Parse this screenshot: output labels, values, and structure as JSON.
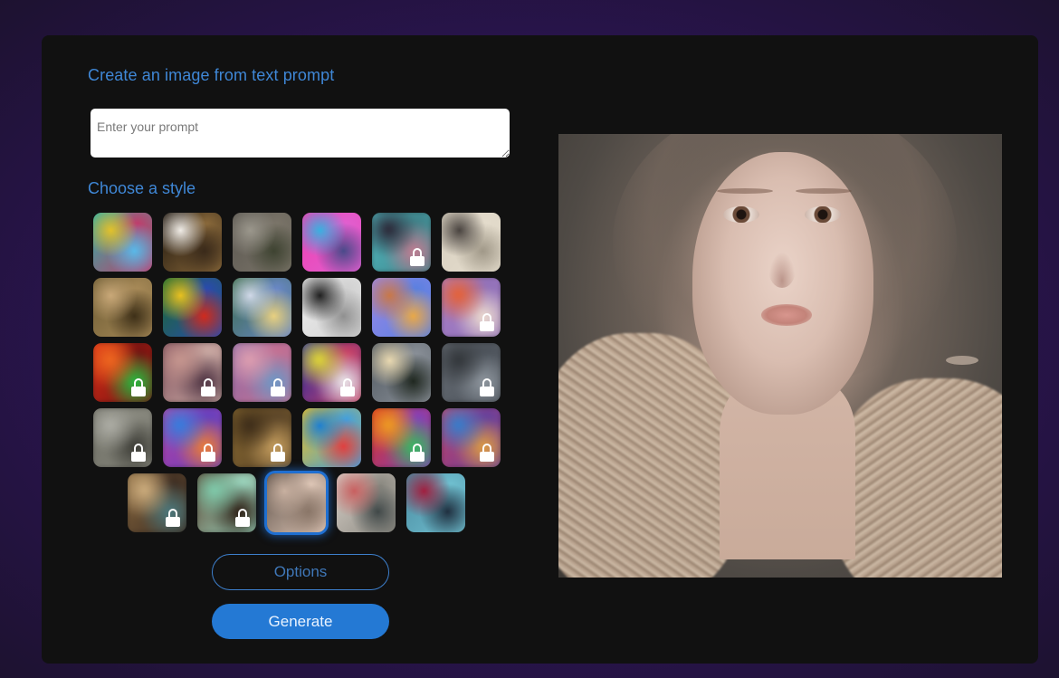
{
  "header": {
    "title": "Create an image from text prompt"
  },
  "prompt": {
    "placeholder": "Enter your prompt",
    "value": ""
  },
  "styles": {
    "label": "Choose a style",
    "accent_color": "#1f6fd1",
    "selected_index": 26,
    "items": [
      {
        "name": "abstract-paint",
        "locked": false,
        "colors": [
          "#2bb3a8",
          "#e2c12b",
          "#5ab8e8",
          "#c23b6a"
        ]
      },
      {
        "name": "panda",
        "locked": false,
        "colors": [
          "#1b130c",
          "#f0ece6",
          "#3a2a1a",
          "#8b6a3b"
        ]
      },
      {
        "name": "misty-forest",
        "locked": false,
        "colors": [
          "#5a5650",
          "#9b978c",
          "#3e4331",
          "#7b7569"
        ]
      },
      {
        "name": "neon-robot",
        "locked": false,
        "colors": [
          "#f03fb0",
          "#3ab0e0",
          "#4a4a8a",
          "#e060d0"
        ]
      },
      {
        "name": "anime-girl",
        "locked": true,
        "colors": [
          "#54c2c8",
          "#2a2030",
          "#c77a90",
          "#3d7f86"
        ]
      },
      {
        "name": "victorian-engraving",
        "locked": false,
        "colors": [
          "#d8d0c0",
          "#4a4440",
          "#a09888",
          "#e4dccc"
        ]
      },
      {
        "name": "renaissance-portrait",
        "locked": false,
        "colors": [
          "#6b5a32",
          "#c9a878",
          "#3e3018",
          "#a88a58"
        ]
      },
      {
        "name": "folk-flowers",
        "locked": false,
        "colors": [
          "#1a6a2a",
          "#e8c020",
          "#d02a1e",
          "#2a4ab0"
        ]
      },
      {
        "name": "impressionist-dancers",
        "locked": false,
        "colors": [
          "#3a6a4a",
          "#d0d8e8",
          "#e8d080",
          "#6a88c8"
        ]
      },
      {
        "name": "op-art-cup",
        "locked": false,
        "colors": [
          "#f0f0f0",
          "#202020",
          "#909090",
          "#d0d0d0"
        ]
      },
      {
        "name": "isometric-room",
        "locked": false,
        "colors": [
          "#9a88e8",
          "#c87848",
          "#e8a848",
          "#5a80e0"
        ]
      },
      {
        "name": "fox-3d",
        "locked": true,
        "colors": [
          "#a880c8",
          "#e86030",
          "#f0e0d0",
          "#9070b8"
        ]
      },
      {
        "name": "neon-skull",
        "locked": true,
        "colors": [
          "#e03018",
          "#f06a20",
          "#20c040",
          "#701010"
        ]
      },
      {
        "name": "vintage-woman",
        "locked": true,
        "colors": [
          "#7a4a58",
          "#c89890",
          "#4a3040",
          "#d0b0a8"
        ]
      },
      {
        "name": "pastel-clouds",
        "locked": true,
        "colors": [
          "#8a6aa8",
          "#e0a0b0",
          "#6a9ac8",
          "#c87090"
        ]
      },
      {
        "name": "pop-art",
        "locked": true,
        "colors": [
          "#1a2aa8",
          "#e8e030",
          "#f0f0f0",
          "#d04060"
        ]
      },
      {
        "name": "modern-house",
        "locked": false,
        "colors": [
          "#505860",
          "#e8d8b0",
          "#202820",
          "#8a9098"
        ]
      },
      {
        "name": "dark-cloud",
        "locked": true,
        "colors": [
          "#6a7078",
          "#303438",
          "#9098a0",
          "#4a5058"
        ]
      },
      {
        "name": "camouflage",
        "locked": true,
        "colors": [
          "#6a6a60",
          "#b0b0a8",
          "#3a3a34",
          "#8a8a80"
        ]
      },
      {
        "name": "neon-rabbit",
        "locked": true,
        "colors": [
          "#c040a0",
          "#3080e0",
          "#f08030",
          "#6040c0"
        ]
      },
      {
        "name": "oil-painting",
        "locked": true,
        "colors": [
          "#8a6a30",
          "#3a2a18",
          "#c8a060",
          "#5a4428"
        ]
      },
      {
        "name": "icon-grid",
        "locked": false,
        "colors": [
          "#f0c020",
          "#2080d0",
          "#e04040",
          "#40a0e0"
        ]
      },
      {
        "name": "neon-dragon",
        "locked": true,
        "colors": [
          "#e03018",
          "#f0a020",
          "#30c060",
          "#8040c0"
        ]
      },
      {
        "name": "psychedelic-face",
        "locked": true,
        "colors": [
          "#d04060",
          "#3080d0",
          "#e0a040",
          "#6040a0"
        ]
      },
      {
        "name": "fantasy-warrior",
        "locked": true,
        "colors": [
          "#8a6a40",
          "#d0b080",
          "#4a7a80",
          "#3a2a20"
        ]
      },
      {
        "name": "teal-abstract",
        "locked": true,
        "colors": [
          "#5a3a28",
          "#80d0b0",
          "#2a1a10",
          "#a0e0c8"
        ]
      },
      {
        "name": "ethereal-portrait",
        "locked": false,
        "colors": [
          "#5a4e46",
          "#c8b0a0",
          "#8a7668",
          "#e0c8b8"
        ]
      },
      {
        "name": "ink-watercolor",
        "locked": false,
        "colors": [
          "#d8d0c8",
          "#c86060",
          "#404848",
          "#8a8880"
        ]
      },
      {
        "name": "cyber-portrait",
        "locked": false,
        "colors": [
          "#4a8aa0",
          "#a02040",
          "#203040",
          "#70c0d0"
        ]
      }
    ]
  },
  "buttons": {
    "options": "Options",
    "generate": "Generate"
  },
  "result": {
    "alt": "Generated portrait of a woman in lace"
  }
}
